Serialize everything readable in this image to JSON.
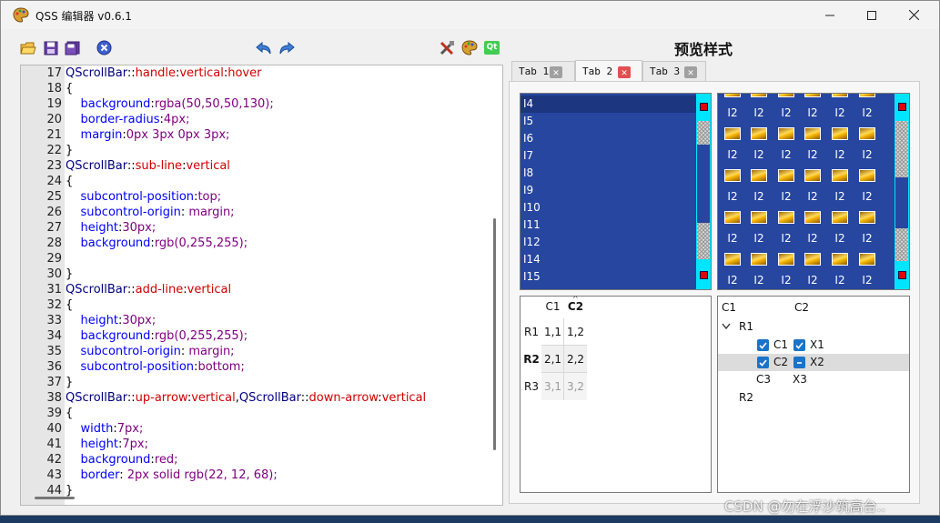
{
  "window": {
    "title": "QSS 编辑器 v0.6.1"
  },
  "toolbar": {
    "buttons": [
      "open-icon",
      "save-icon",
      "save-as-icon",
      "close-file-icon",
      "undo-icon",
      "redo-icon",
      "tools-icon",
      "palette-icon",
      "qt-icon"
    ],
    "qt_label": "Qt"
  },
  "editor": {
    "lines": [
      {
        "n": "17",
        "parts": [
          [
            "QScrollBar",
            "n"
          ],
          [
            "::",
            "b"
          ],
          [
            "handle",
            "r"
          ],
          [
            ":",
            "b"
          ],
          [
            "vertical",
            "r"
          ],
          [
            ":",
            "b"
          ],
          [
            "hover",
            "r"
          ]
        ]
      },
      {
        "n": "18",
        "parts": [
          [
            "{",
            "b"
          ]
        ]
      },
      {
        "n": "19",
        "parts": [
          [
            "    ",
            "b"
          ],
          [
            "background",
            "k"
          ],
          [
            ":",
            "b"
          ],
          [
            "rgba(50,50,50,130);",
            "p"
          ]
        ]
      },
      {
        "n": "20",
        "parts": [
          [
            "    ",
            "b"
          ],
          [
            "border-radius",
            "k"
          ],
          [
            ":",
            "b"
          ],
          [
            "4px;",
            "p"
          ]
        ]
      },
      {
        "n": "21",
        "parts": [
          [
            "    ",
            "b"
          ],
          [
            "margin",
            "k"
          ],
          [
            ":",
            "b"
          ],
          [
            "0px 3px 0px 3px;",
            "p"
          ]
        ]
      },
      {
        "n": "22",
        "parts": [
          [
            "}",
            "b"
          ]
        ]
      },
      {
        "n": "23",
        "parts": [
          [
            "QScrollBar",
            "n"
          ],
          [
            "::",
            "b"
          ],
          [
            "sub-line",
            "r"
          ],
          [
            ":",
            "b"
          ],
          [
            "vertical",
            "r"
          ]
        ]
      },
      {
        "n": "24",
        "parts": [
          [
            "{",
            "b"
          ]
        ]
      },
      {
        "n": "25",
        "parts": [
          [
            "    ",
            "b"
          ],
          [
            "subcontrol-position",
            "k"
          ],
          [
            ":",
            "b"
          ],
          [
            "top;",
            "p"
          ]
        ]
      },
      {
        "n": "26",
        "parts": [
          [
            "    ",
            "b"
          ],
          [
            "subcontrol-origin",
            "k"
          ],
          [
            ": ",
            "b"
          ],
          [
            "margin;",
            "p"
          ]
        ]
      },
      {
        "n": "27",
        "parts": [
          [
            "    ",
            "b"
          ],
          [
            "height",
            "k"
          ],
          [
            ":",
            "b"
          ],
          [
            "30px;",
            "p"
          ]
        ]
      },
      {
        "n": "28",
        "parts": [
          [
            "    ",
            "b"
          ],
          [
            "background",
            "k"
          ],
          [
            ":",
            "b"
          ],
          [
            "rgb(0,255,255);",
            "p"
          ]
        ]
      },
      {
        "n": "29",
        "parts": []
      },
      {
        "n": "30",
        "parts": [
          [
            "}",
            "b"
          ]
        ]
      },
      {
        "n": "31",
        "parts": [
          [
            "QScrollBar",
            "n"
          ],
          [
            "::",
            "b"
          ],
          [
            "add-line",
            "r"
          ],
          [
            ":",
            "b"
          ],
          [
            "vertical",
            "r"
          ]
        ]
      },
      {
        "n": "32",
        "parts": [
          [
            "{",
            "b"
          ]
        ]
      },
      {
        "n": "33",
        "parts": [
          [
            "    ",
            "b"
          ],
          [
            "height",
            "k"
          ],
          [
            ":",
            "b"
          ],
          [
            "30px;",
            "p"
          ]
        ]
      },
      {
        "n": "34",
        "parts": [
          [
            "    ",
            "b"
          ],
          [
            "background",
            "k"
          ],
          [
            ":",
            "b"
          ],
          [
            "rgb(0,255,255);",
            "p"
          ]
        ]
      },
      {
        "n": "35",
        "parts": [
          [
            "    ",
            "b"
          ],
          [
            "subcontrol-origin",
            "k"
          ],
          [
            ": ",
            "b"
          ],
          [
            "margin;",
            "p"
          ]
        ]
      },
      {
        "n": "36",
        "parts": [
          [
            "    ",
            "b"
          ],
          [
            "subcontrol-position",
            "k"
          ],
          [
            ":",
            "b"
          ],
          [
            "bottom;",
            "p"
          ]
        ]
      },
      {
        "n": "37",
        "parts": [
          [
            "}",
            "b"
          ]
        ]
      },
      {
        "n": "38",
        "parts": [
          [
            "QScrollBar",
            "n"
          ],
          [
            "::",
            "b"
          ],
          [
            "up-arrow",
            "r"
          ],
          [
            ":",
            "b"
          ],
          [
            "vertical",
            "r"
          ],
          [
            ",",
            "b"
          ],
          [
            "QScrollBar",
            "n"
          ],
          [
            "::",
            "b"
          ],
          [
            "down-arrow",
            "r"
          ],
          [
            ":",
            "b"
          ],
          [
            "vertical",
            "r"
          ]
        ]
      },
      {
        "n": "39",
        "parts": [
          [
            "{",
            "b"
          ]
        ]
      },
      {
        "n": "40",
        "parts": [
          [
            "    ",
            "b"
          ],
          [
            "width",
            "k"
          ],
          [
            ":",
            "b"
          ],
          [
            "7px;",
            "p"
          ]
        ]
      },
      {
        "n": "41",
        "parts": [
          [
            "    ",
            "b"
          ],
          [
            "height",
            "k"
          ],
          [
            ":",
            "b"
          ],
          [
            "7px;",
            "p"
          ]
        ]
      },
      {
        "n": "42",
        "parts": [
          [
            "    ",
            "b"
          ],
          [
            "background",
            "k"
          ],
          [
            ":",
            "b"
          ],
          [
            "red;",
            "p"
          ]
        ]
      },
      {
        "n": "43",
        "parts": [
          [
            "    ",
            "b"
          ],
          [
            "border",
            "k"
          ],
          [
            ": ",
            "b"
          ],
          [
            "2px solid rgb(22, 12, 68);",
            "p"
          ]
        ]
      },
      {
        "n": "44",
        "parts": [
          [
            "}",
            "b"
          ]
        ]
      }
    ]
  },
  "preview": {
    "title": "预览样式",
    "tabs": [
      {
        "label": "Tab 1",
        "close_style": "grey"
      },
      {
        "label": "Tab 2",
        "close_style": "red",
        "active": true
      },
      {
        "label": "Tab 3",
        "close_style": "grey"
      }
    ],
    "list_items": [
      "I4",
      "I5",
      "I6",
      "I7",
      "I8",
      "I9",
      "I10",
      "I11",
      "I12",
      "I14",
      "I15"
    ],
    "selected_item": "I4",
    "icon_label": "I2",
    "table": {
      "col_headers": [
        "C1",
        "C2"
      ],
      "row_headers": [
        "R1",
        "R2",
        "R3"
      ],
      "cells": [
        [
          "1,1",
          "1,2"
        ],
        [
          "2,1",
          "2,2"
        ],
        [
          "3,1",
          "3,2"
        ]
      ]
    },
    "tree": {
      "headers": [
        "C1",
        "C2"
      ],
      "root": "R1",
      "rows": [
        {
          "c1": "C1",
          "c2": "X1",
          "check1": "checked",
          "check2": "checked"
        },
        {
          "c1": "C2",
          "c2": "X2",
          "check1": "checked",
          "check2": "partial"
        },
        {
          "c1": "C3",
          "c2": "X3",
          "disabled": true
        }
      ],
      "root2": "R2"
    }
  },
  "watermark": "CSDN @勿在浮沙筑高台.."
}
